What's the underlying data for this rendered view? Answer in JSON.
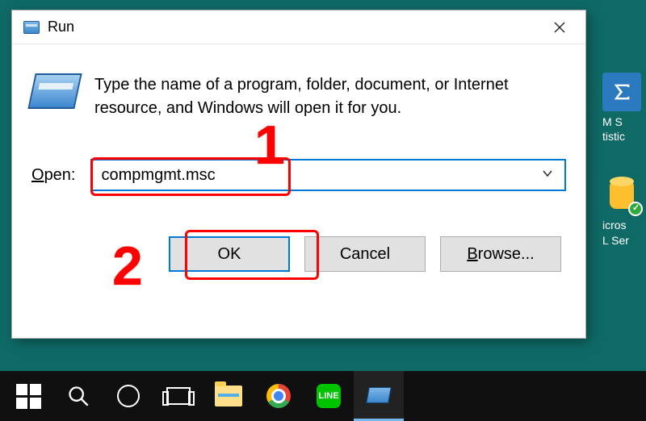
{
  "dialog": {
    "title": "Run",
    "instruction": "Type the name of a program, folder, document, or Internet resource, and Windows will open it for you.",
    "open_label_pre": "O",
    "open_label_post": "pen:",
    "input_value": "compmgmt.msc",
    "buttons": {
      "ok": "OK",
      "cancel": "Cancel",
      "browse_pre": "B",
      "browse_post": "rowse..."
    }
  },
  "annotations": {
    "one": "1",
    "two": "2"
  },
  "desktop": {
    "item1_l1": "M S",
    "item1_l2": "tistic",
    "item2_l1": "icros",
    "item2_l2": "L Ser"
  },
  "taskbar": {
    "line_label": "LINE"
  }
}
